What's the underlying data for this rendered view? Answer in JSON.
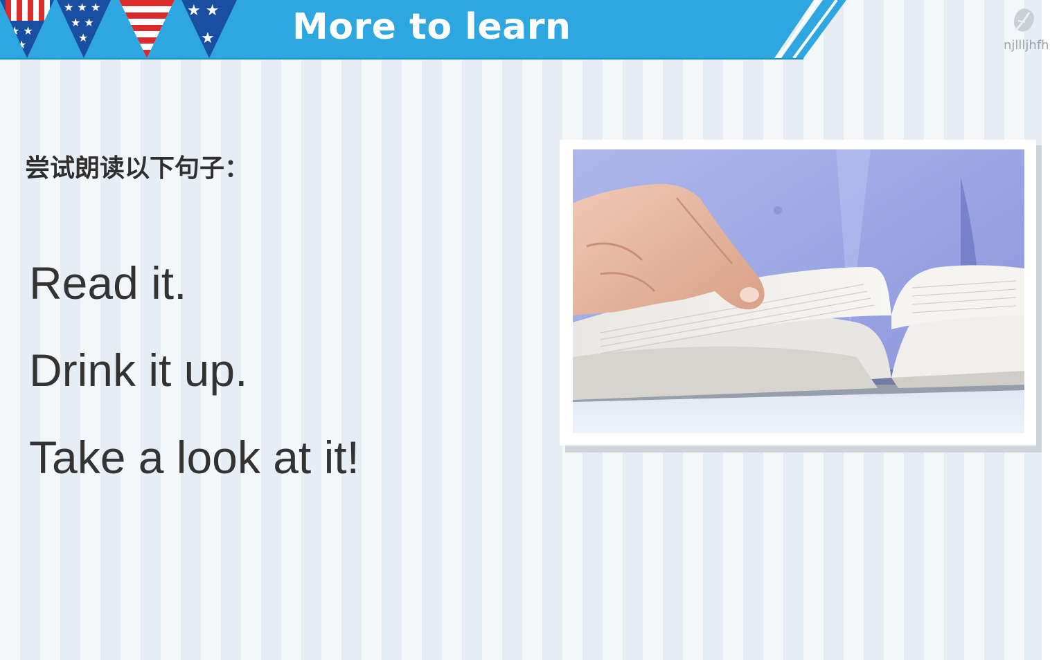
{
  "header": {
    "title": "More to learn",
    "color": "#2ea6e0"
  },
  "watermark": {
    "text": "njllljhfh",
    "icon": "leaf-logo-icon"
  },
  "content": {
    "instruction": "尝试朗读以下句子：",
    "sentences": [
      "Read it.",
      "Drink it up.",
      "Take a look at it!"
    ]
  },
  "image": {
    "subject": "hand-pointing-at-open-book-photo"
  }
}
